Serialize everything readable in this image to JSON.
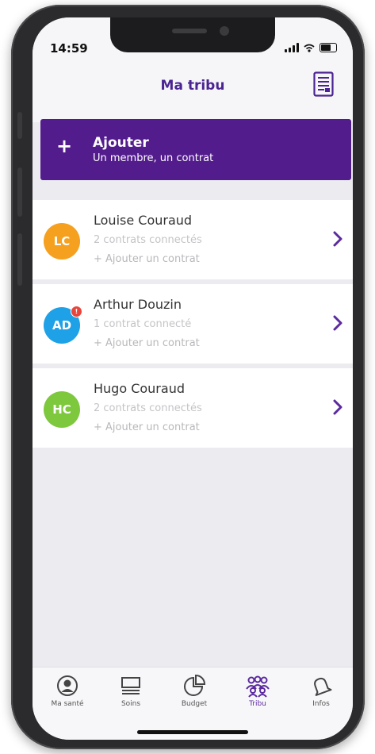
{
  "status_bar": {
    "time": "14:59"
  },
  "header": {
    "title": "Ma tribu",
    "doc_icon": "document-list-icon"
  },
  "add_banner": {
    "plus": "+",
    "title": "Ajouter",
    "subtitle": "Un membre, un contrat"
  },
  "members": [
    {
      "initials": "LC",
      "name": "Louise Couraud",
      "contracts": "2 contrats connectés",
      "add_contract": "+ Ajouter un contrat",
      "avatar_color": "#f5a01e",
      "badge": ""
    },
    {
      "initials": "AD",
      "name": "Arthur Douzin",
      "contracts": "1 contrat connecté",
      "add_contract": "+ Ajouter un contrat",
      "avatar_color": "#1ea1e6",
      "badge": "!"
    },
    {
      "initials": "HC",
      "name": "Hugo Couraud",
      "contracts": "2 contrats connectés",
      "add_contract": "+ Ajouter un contrat",
      "avatar_color": "#7dc83c",
      "badge": ""
    }
  ],
  "tabs": [
    {
      "label": "Ma santé",
      "icon": "person-circle-icon",
      "active": false
    },
    {
      "label": "Soins",
      "icon": "stack-icon",
      "active": false
    },
    {
      "label": "Budget",
      "icon": "pie-chart-icon",
      "active": false
    },
    {
      "label": "Tribu",
      "icon": "people-group-icon",
      "active": true
    },
    {
      "label": "Infos",
      "icon": "bell-icon",
      "active": false
    }
  ],
  "colors": {
    "brand_purple": "#531c8c",
    "title_purple": "#4a2492",
    "background": "#ececf0"
  }
}
